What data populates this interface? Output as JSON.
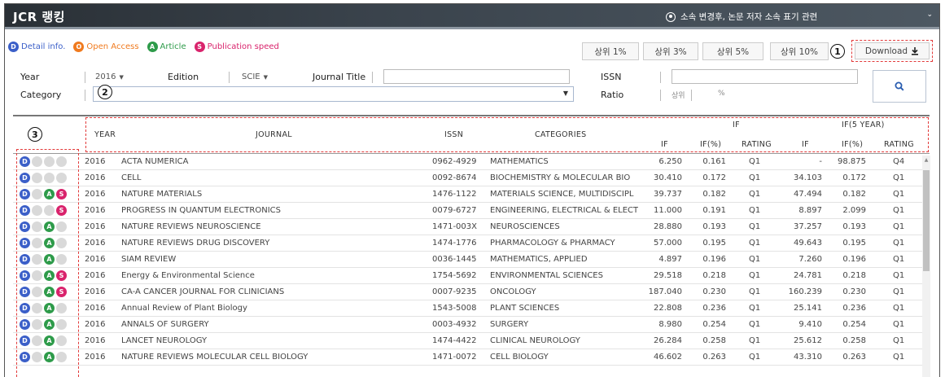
{
  "app": {
    "title": "JCR 랭킹",
    "notice": "소속 변경후, 논문 저자 소속 표기 관련",
    "collapse_toggle": "⌄"
  },
  "legend": [
    {
      "badge": "D",
      "label": "Detail info.",
      "color": "#3b5fc8"
    },
    {
      "badge": "O",
      "label": "Open Access",
      "color": "#f07a1e"
    },
    {
      "badge": "A",
      "label": "Article",
      "color": "#2e9b4a"
    },
    {
      "badge": "S",
      "label": "Publication speed",
      "color": "#d9236c"
    }
  ],
  "rank_buttons": [
    "상위 1%",
    "상위 3%",
    "상위 5%",
    "상위 10%"
  ],
  "download_label": "Download",
  "callouts": [
    "1",
    "2",
    "3"
  ],
  "search": {
    "year_label": "Year",
    "year_value": "2016",
    "edition_label": "Edition",
    "edition_value": "SCIE",
    "journal_title_label": "Journal Title",
    "journal_title_value": "",
    "issn_label": "ISSN",
    "issn_value": "",
    "category_label": "Category",
    "category_value": "",
    "ratio_label": "Ratio",
    "ratio_prefix": "상위",
    "ratio_value": "",
    "ratio_unit": "%",
    "search_icon": "search-icon"
  },
  "table": {
    "headers": {
      "year": "YEAR",
      "journal": "JOURNAL",
      "issn": "ISSN",
      "categories": "CATEGORIES",
      "if_group": "IF",
      "if5_group": "IF(5 YEAR)",
      "if": "IF",
      "if_pct": "IF(%)",
      "rating": "RATING",
      "if5": "IF",
      "if5_pct": "IF(%)",
      "rating5": "RATING"
    },
    "rows": [
      {
        "icons": [
          "D",
          "-",
          "-",
          "-"
        ],
        "year": "2016",
        "journal": "ACTA NUMERICA",
        "issn": "0962-4929",
        "category": "MATHEMATICS",
        "if": "6.250",
        "if_pct": "0.161",
        "rating": "Q1",
        "if5": "-",
        "if5_pct": "98.875",
        "rating5": "Q4"
      },
      {
        "icons": [
          "D",
          "-",
          "-",
          "-"
        ],
        "year": "2016",
        "journal": "CELL",
        "issn": "0092-8674",
        "category": "BIOCHEMISTRY & MOLECULAR BIO",
        "if": "30.410",
        "if_pct": "0.172",
        "rating": "Q1",
        "if5": "34.103",
        "if5_pct": "0.172",
        "rating5": "Q1"
      },
      {
        "icons": [
          "D",
          "-",
          "A",
          "S"
        ],
        "year": "2016",
        "journal": "NATURE MATERIALS",
        "issn": "1476-1122",
        "category": "MATERIALS SCIENCE, MULTIDISCIPL",
        "if": "39.737",
        "if_pct": "0.182",
        "rating": "Q1",
        "if5": "47.494",
        "if5_pct": "0.182",
        "rating5": "Q1"
      },
      {
        "icons": [
          "D",
          "-",
          "-",
          "S"
        ],
        "year": "2016",
        "journal": "PROGRESS IN QUANTUM ELECTRONICS",
        "issn": "0079-6727",
        "category": "ENGINEERING, ELECTRICAL & ELECT",
        "if": "11.000",
        "if_pct": "0.191",
        "rating": "Q1",
        "if5": "8.897",
        "if5_pct": "2.099",
        "rating5": "Q1"
      },
      {
        "icons": [
          "D",
          "-",
          "A",
          "-"
        ],
        "year": "2016",
        "journal": "NATURE REVIEWS NEUROSCIENCE",
        "issn": "1471-003X",
        "category": "NEUROSCIENCES",
        "if": "28.880",
        "if_pct": "0.193",
        "rating": "Q1",
        "if5": "37.257",
        "if5_pct": "0.193",
        "rating5": "Q1"
      },
      {
        "icons": [
          "D",
          "-",
          "A",
          "-"
        ],
        "year": "2016",
        "journal": "NATURE REVIEWS DRUG DISCOVERY",
        "issn": "1474-1776",
        "category": "PHARMACOLOGY & PHARMACY",
        "if": "57.000",
        "if_pct": "0.195",
        "rating": "Q1",
        "if5": "49.643",
        "if5_pct": "0.195",
        "rating5": "Q1"
      },
      {
        "icons": [
          "D",
          "-",
          "A",
          "-"
        ],
        "year": "2016",
        "journal": "SIAM REVIEW",
        "issn": "0036-1445",
        "category": "MATHEMATICS, APPLIED",
        "if": "4.897",
        "if_pct": "0.196",
        "rating": "Q1",
        "if5": "7.260",
        "if5_pct": "0.196",
        "rating5": "Q1"
      },
      {
        "icons": [
          "D",
          "-",
          "A",
          "S"
        ],
        "year": "2016",
        "journal": "Energy & Environmental Science",
        "issn": "1754-5692",
        "category": "ENVIRONMENTAL SCIENCES",
        "if": "29.518",
        "if_pct": "0.218",
        "rating": "Q1",
        "if5": "24.781",
        "if5_pct": "0.218",
        "rating5": "Q1"
      },
      {
        "icons": [
          "D",
          "-",
          "A",
          "S"
        ],
        "year": "2016",
        "journal": "CA-A CANCER JOURNAL FOR CLINICIANS",
        "issn": "0007-9235",
        "category": "ONCOLOGY",
        "if": "187.040",
        "if_pct": "0.230",
        "rating": "Q1",
        "if5": "160.239",
        "if5_pct": "0.230",
        "rating5": "Q1"
      },
      {
        "icons": [
          "D",
          "-",
          "A",
          "-"
        ],
        "year": "2016",
        "journal": "Annual Review of Plant Biology",
        "issn": "1543-5008",
        "category": "PLANT SCIENCES",
        "if": "22.808",
        "if_pct": "0.236",
        "rating": "Q1",
        "if5": "25.141",
        "if5_pct": "0.236",
        "rating5": "Q1"
      },
      {
        "icons": [
          "D",
          "-",
          "A",
          "-"
        ],
        "year": "2016",
        "journal": "ANNALS OF SURGERY",
        "issn": "0003-4932",
        "category": "SURGERY",
        "if": "8.980",
        "if_pct": "0.254",
        "rating": "Q1",
        "if5": "9.410",
        "if5_pct": "0.254",
        "rating5": "Q1"
      },
      {
        "icons": [
          "D",
          "-",
          "A",
          "-"
        ],
        "year": "2016",
        "journal": "LANCET NEUROLOGY",
        "issn": "1474-4422",
        "category": "CLINICAL NEUROLOGY",
        "if": "26.284",
        "if_pct": "0.258",
        "rating": "Q1",
        "if5": "25.612",
        "if5_pct": "0.258",
        "rating5": "Q1"
      },
      {
        "icons": [
          "D",
          "-",
          "A",
          "-"
        ],
        "year": "2016",
        "journal": "NATURE REVIEWS MOLECULAR CELL BIOLOGY",
        "issn": "1471-0072",
        "category": "CELL BIOLOGY",
        "if": "46.602",
        "if_pct": "0.263",
        "rating": "Q1",
        "if5": "43.310",
        "if5_pct": "0.263",
        "rating5": "Q1"
      }
    ]
  }
}
